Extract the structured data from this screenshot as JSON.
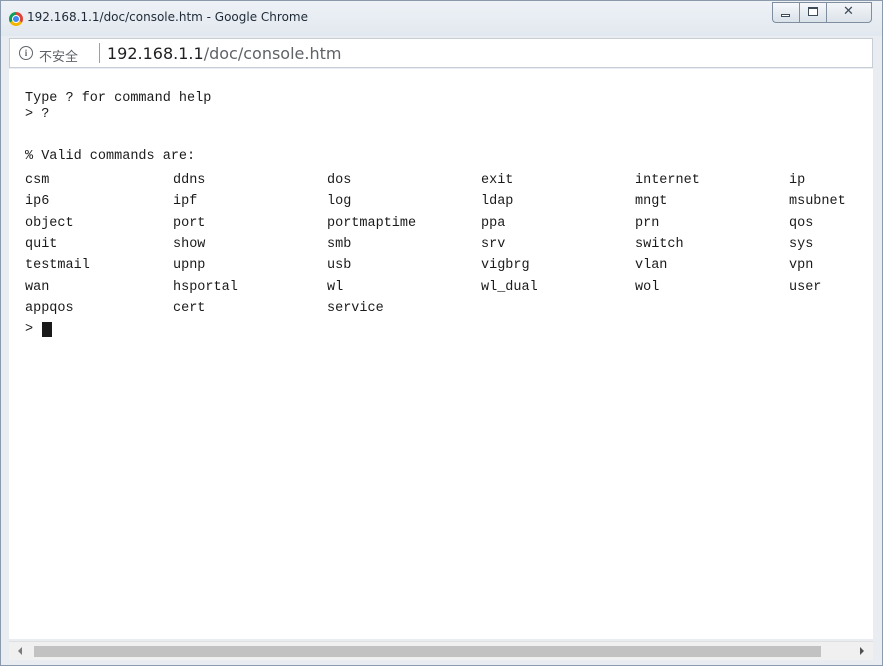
{
  "window": {
    "title": "192.168.1.1/doc/console.htm - Google Chrome",
    "controls": {
      "minimize": "minimize",
      "maximize": "maximize",
      "close": "✕"
    }
  },
  "address_bar": {
    "security_label": "不安全",
    "url_host": "192.168.1.1",
    "url_path": "/doc/console.htm",
    "info_glyph": "i"
  },
  "console": {
    "intro": "Type ? for command help",
    "first_prompt": "> ?",
    "valid_header": "% Valid commands are:",
    "commands": [
      [
        "csm",
        "ddns",
        "dos",
        "exit",
        "internet",
        "ip"
      ],
      [
        "ip6",
        "ipf",
        "log",
        "ldap",
        "mngt",
        "msubnet"
      ],
      [
        "object",
        "port",
        "portmaptime",
        "ppa",
        "prn",
        "qos"
      ],
      [
        "quit",
        "show",
        "smb",
        "srv",
        "switch",
        "sys"
      ],
      [
        "testmail",
        "upnp",
        "usb",
        "vigbrg",
        "vlan",
        "vpn"
      ],
      [
        "wan",
        "hsportal",
        "wl",
        "wl_dual",
        "wol",
        "user"
      ],
      [
        "appqos",
        "cert",
        "service"
      ]
    ],
    "final_prompt": ">"
  }
}
